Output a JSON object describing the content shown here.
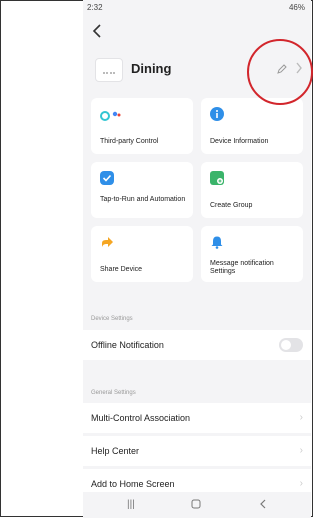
{
  "status": {
    "time": "2:32",
    "battery": "46%"
  },
  "device": {
    "name": "Dining"
  },
  "cards": [
    {
      "label": "Third-party Control",
      "icon": "assistant-icon"
    },
    {
      "label": "Device Information",
      "icon": "info-icon"
    },
    {
      "label": "Tap-to-Run and Automation",
      "icon": "check-icon"
    },
    {
      "label": "Create Group",
      "icon": "group-icon"
    },
    {
      "label": "Share Device",
      "icon": "share-icon"
    },
    {
      "label": "Message notification Settings",
      "icon": "bell-icon"
    }
  ],
  "device_settings": {
    "title": "Device Settings",
    "offline": "Offline Notification"
  },
  "general_settings": {
    "title": "General Settings",
    "items": [
      "Multi-Control Association",
      "Help Center",
      "Add to Home Screen"
    ]
  },
  "colors": {
    "blue": "#2f8fe8",
    "green": "#3ab46a",
    "orange": "#f5a623",
    "annotation": "#d2262c"
  }
}
